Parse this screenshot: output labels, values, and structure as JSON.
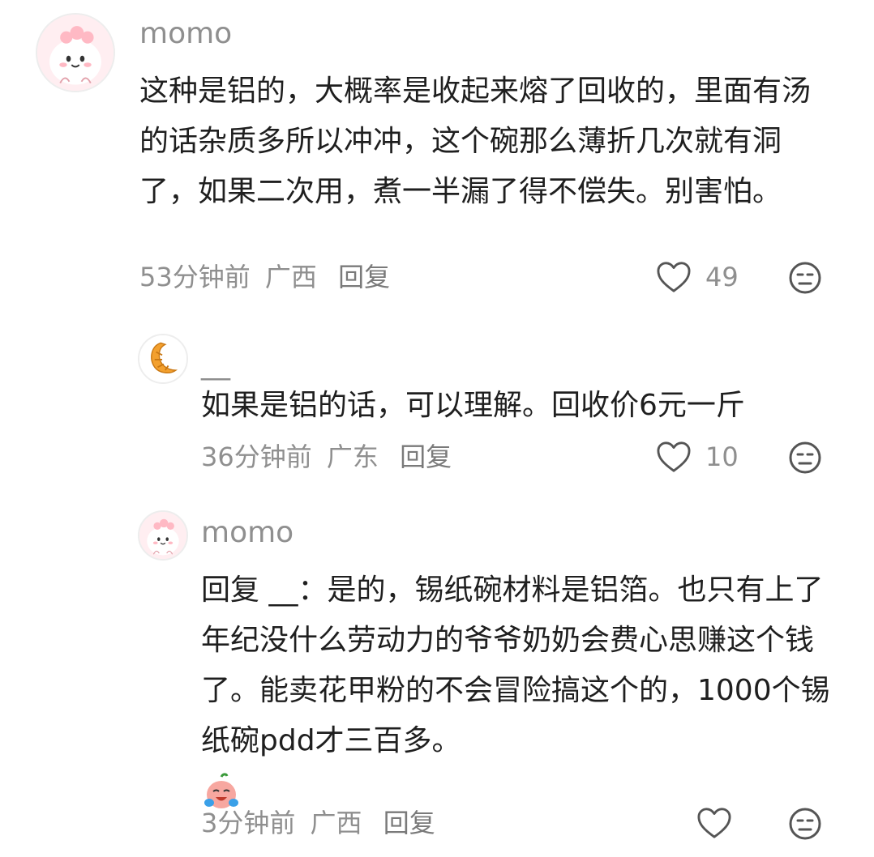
{
  "comments": [
    {
      "username": "momo",
      "content": "这种是铝的，大概率是收起来熔了回收的，里面有汤的话杂质多所以冲冲，这个碗那么薄折几次就有洞了，如果二次用，煮一半漏了得不偿失。别害怕。",
      "time": "53分钟前",
      "location": "广西",
      "reply_label": "回复",
      "likes": "49",
      "avatar_icon": "pink-cartoon-avatar-icon"
    },
    {
      "username": "__",
      "content": "如果是铝的话，可以理解。回收价6元一斤",
      "time": "36分钟前",
      "location": "广东",
      "reply_label": "回复",
      "likes": "10",
      "avatar_icon": "croissant-avatar-icon"
    },
    {
      "username": "momo",
      "content": "回复  __：是的，锡纸碗材料是铝箔。也只有上了年纪没什么劳动力的爷爷奶奶会费心思赚这个钱了。能卖花甲粉的不会冒险搞这个的，1000个锡纸碗pdd才三百多。",
      "emoji": "crying-laughing-emoji-icon",
      "time": "3分钟前",
      "location": "广西",
      "reply_label": "回复",
      "likes": "",
      "avatar_icon": "pink-cartoon-avatar-icon"
    }
  ],
  "colors": {
    "text": "#1f1f1f",
    "meta": "#8f8f8f",
    "avatar_bg": "#ffeef1"
  }
}
